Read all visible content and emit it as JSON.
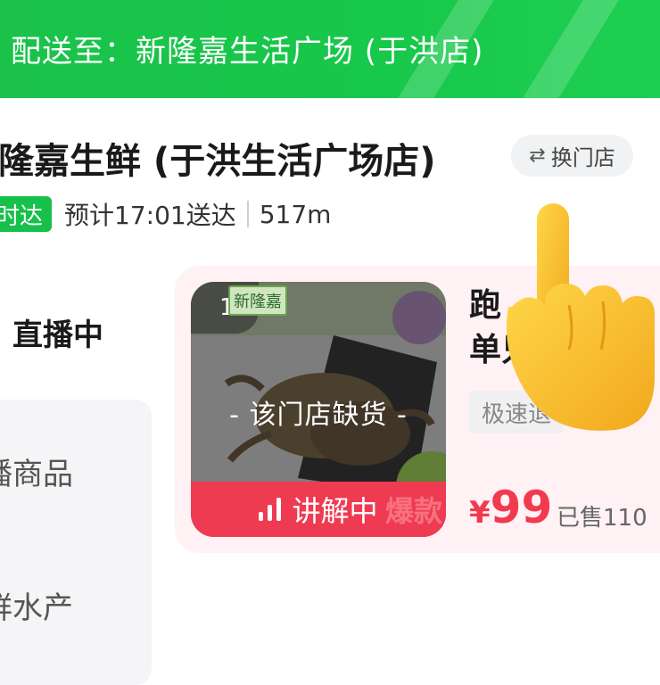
{
  "header": {
    "deliver_to": "配送至：新隆嘉生活广场 (于洪店)"
  },
  "store": {
    "name": "隆嘉生鲜 (于洪生活广场店)",
    "switch_label": "换门店",
    "badge": "时达",
    "eta": "预计17:01送达",
    "distance": "517m"
  },
  "menu": {
    "live": "直播中",
    "items": [
      "播商品",
      "鲜水产"
    ]
  },
  "product": {
    "rank": "1",
    "brand_tag": "新隆嘉",
    "stock_status": "- 该门店缺货 -",
    "explain_label": "讲解中",
    "hot_tag": "爆款",
    "title_line1": "跑",
    "title_line2": "单只",
    "return_tag": "极速退",
    "currency": "¥",
    "price": "99",
    "sold": "已售110"
  },
  "colors": {
    "brand_green": "#17c04a",
    "price_red": "#f23a4f",
    "explain_red": "#ee3b52",
    "card_bg": "#fff1f4"
  },
  "icons": [
    "switch-icon",
    "signal-bars-icon",
    "pointing-hand-icon"
  ]
}
